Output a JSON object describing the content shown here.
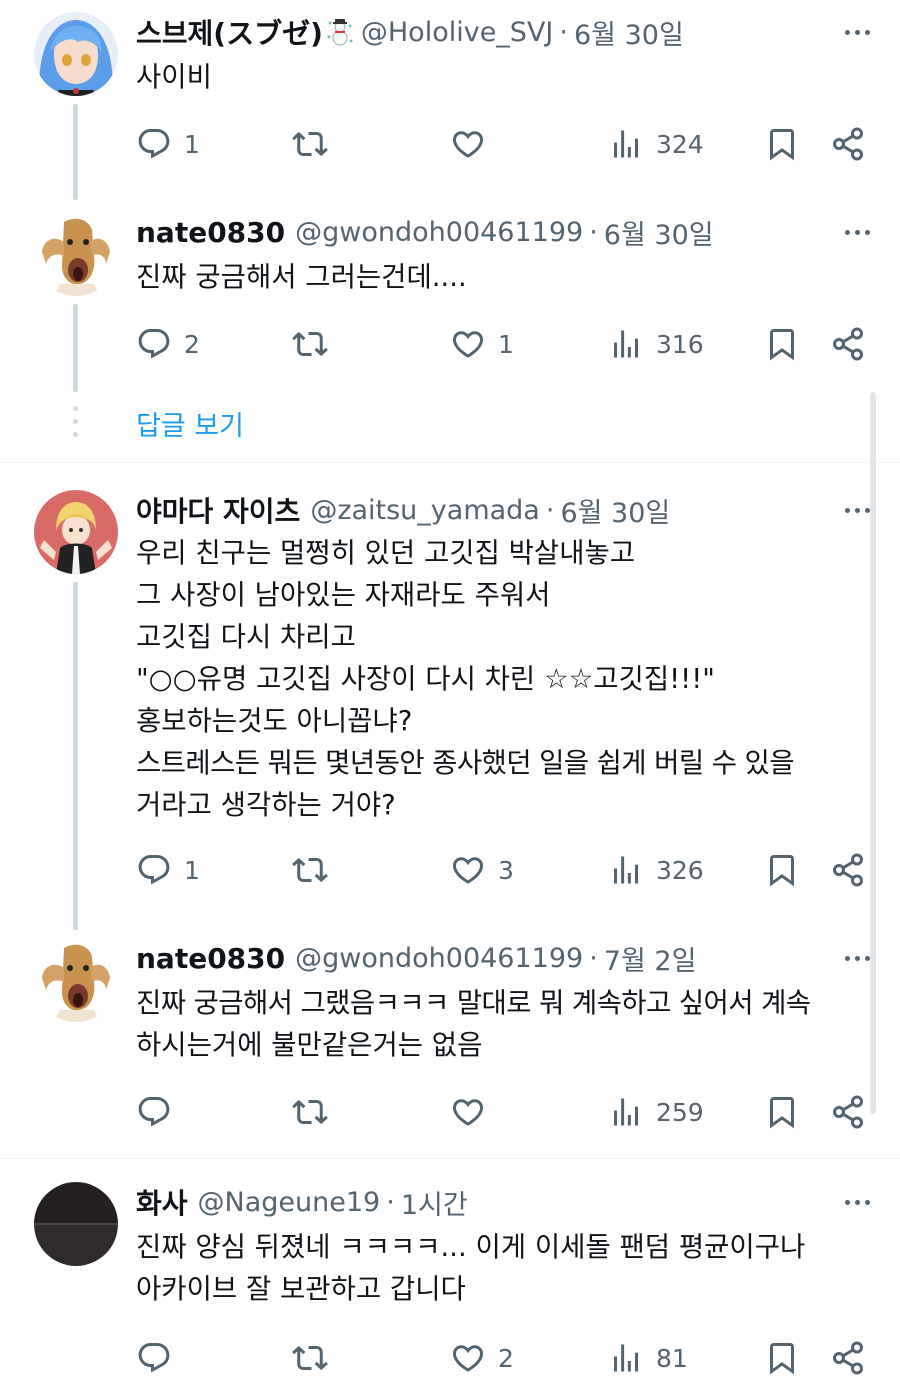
{
  "tweets": [
    {
      "name": "스브제(スブゼ)",
      "handle": "@Hololive_SVJ",
      "date": "6월 30일",
      "text": [
        "사이비"
      ],
      "replies": "1",
      "retweets": "",
      "likes": "",
      "views": "324",
      "avatar_icon": "blue-haired-anime-avatar",
      "name_emoji": "snowman-icon"
    },
    {
      "name": "nate0830",
      "handle": "@gwondoh00461199",
      "date": "6월 30일",
      "text": [
        "진짜 궁금해서 그러는건데...."
      ],
      "replies": "2",
      "retweets": "",
      "likes": "1",
      "views": "316",
      "avatar_icon": "screaming-horse-avatar"
    },
    {
      "name": "야마다 자이츠",
      "handle": "@zaitsu_yamada",
      "date": "6월 30일",
      "text": [
        "우리 친구는 멀쩡히 있던 고깃집 박살내놓고",
        "그 사장이 남아있는 자재라도 주워서",
        "고깃집 다시 차리고",
        "\"○○유명 고깃집 사장이 다시 차린 ☆☆고깃집!!!\"",
        "홍보하는것도 아니꼽냐?",
        "스트레스든 뭐든 몇년동안 종사했던 일을 쉽게 버릴 수 있을",
        "거라고 생각하는 거야?"
      ],
      "replies": "1",
      "retweets": "",
      "likes": "3",
      "views": "326",
      "avatar_icon": "blonde-anime-avatar"
    },
    {
      "name": "nate0830",
      "handle": "@gwondoh00461199",
      "date": "7월 2일",
      "text": [
        "진짜 궁금해서 그랬음ㅋㅋㅋ 말대로 뭐 계속하고 싶어서 계속",
        "하시는거에 불만같은거는 없음"
      ],
      "replies": "",
      "retweets": "",
      "likes": "",
      "views": "259",
      "avatar_icon": "screaming-horse-avatar"
    },
    {
      "name": "화사",
      "handle": "@Nageune19",
      "date": "1시간",
      "text": [
        "진짜 양심 뒤졌네 ㅋㅋㅋㅋ... 이게 이세돌 팬덤 평균이구나",
        "아카이브 잘 보관하고 갑니다"
      ],
      "replies": "",
      "retweets": "",
      "likes": "2",
      "views": "81",
      "avatar_icon": "dark-avatar"
    }
  ],
  "show_replies_label": "답글 보기",
  "colors": {
    "text": "#0f1419",
    "secondary": "#536471",
    "link": "#1d9bf0",
    "thread_line": "#cfd9de"
  }
}
